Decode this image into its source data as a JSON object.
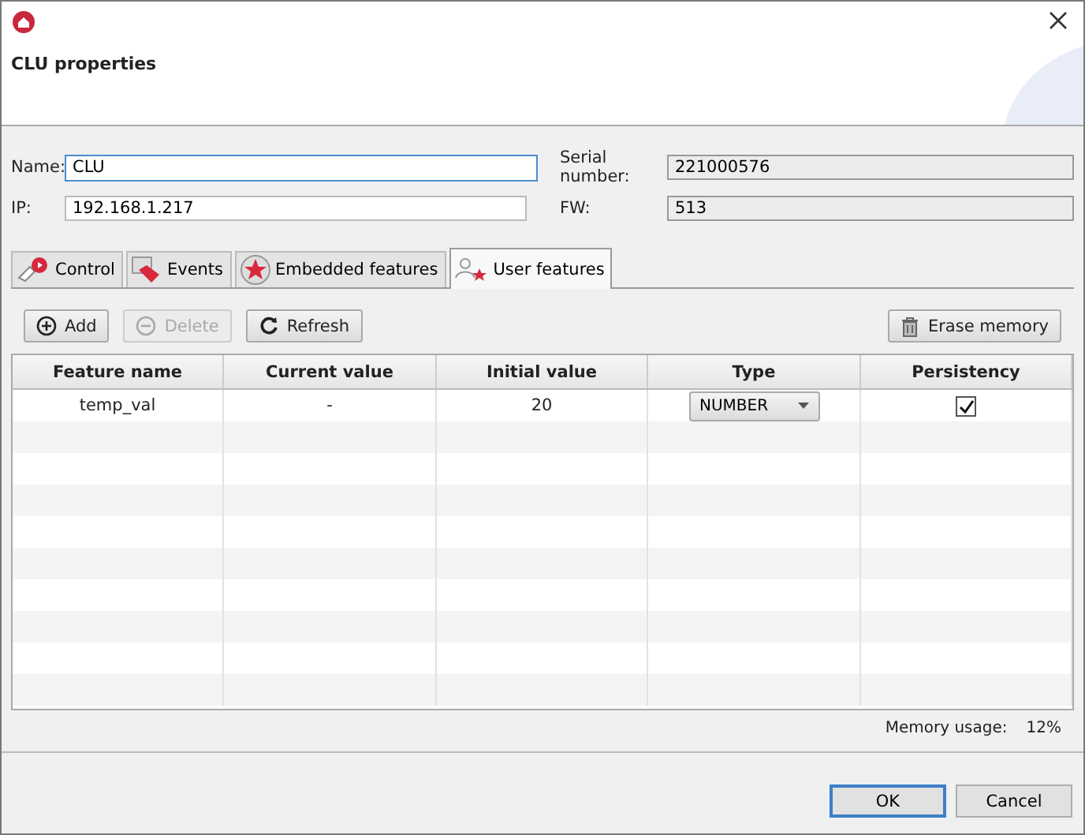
{
  "window": {
    "title": "CLU properties"
  },
  "form": {
    "name": {
      "label": "Name:",
      "value": "CLU"
    },
    "ip": {
      "label": "IP:",
      "value": "192.168.1.217"
    },
    "serial": {
      "label": "Serial number:",
      "value": "221000576"
    },
    "fw": {
      "label": "FW:",
      "value": "513"
    }
  },
  "tabs": [
    {
      "label": "Control",
      "selected": false
    },
    {
      "label": "Events",
      "selected": false
    },
    {
      "label": "Embedded features",
      "selected": false
    },
    {
      "label": "User features",
      "selected": true
    }
  ],
  "toolbar": [
    {
      "label": "Add",
      "disabled": false
    },
    {
      "label": "Delete",
      "disabled": true
    },
    {
      "label": "Refresh",
      "disabled": false
    }
  ],
  "erase_button": "Erase memory",
  "table": {
    "columns": [
      "Feature name",
      "Current value",
      "Initial value",
      "Type",
      "Persistency"
    ],
    "rows": [
      {
        "feature_name": "temp_val",
        "current_value": "-",
        "initial_value": "20",
        "type": "NUMBER",
        "persistency": true
      }
    ]
  },
  "memory": {
    "label": "Memory usage:",
    "value": "12%"
  },
  "buttons": [
    "OK",
    "Cancel"
  ]
}
